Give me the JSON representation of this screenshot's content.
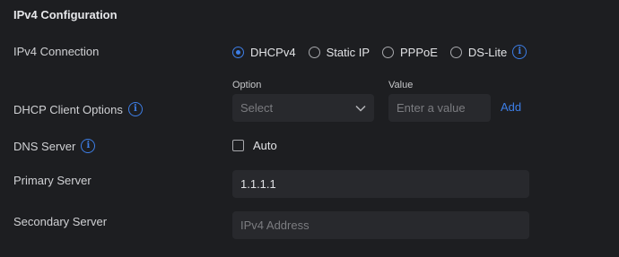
{
  "section": {
    "title": "IPv4 Configuration"
  },
  "ipv4_connection": {
    "label": "IPv4 Connection",
    "options": [
      {
        "label": "DHCPv4",
        "checked": true
      },
      {
        "label": "Static IP",
        "checked": false
      },
      {
        "label": "PPPoE",
        "checked": false
      },
      {
        "label": "DS-Lite",
        "checked": false
      }
    ],
    "info_icon": "info-icon"
  },
  "dhcp_client_options": {
    "label": "DHCP Client Options",
    "option_header": "Option",
    "value_header": "Value",
    "select_value": "Select",
    "value_placeholder": "Enter a value",
    "add_label": "Add"
  },
  "dns_server": {
    "label": "DNS Server",
    "auto_label": "Auto",
    "auto_checked": false
  },
  "primary_server": {
    "label": "Primary Server",
    "value": "1.1.1.1"
  },
  "secondary_server": {
    "label": "Secondary Server",
    "placeholder": "IPv4 Address"
  },
  "colors": {
    "accent": "#3d7ee6",
    "background": "#1d1e21",
    "field": "#28292d"
  }
}
